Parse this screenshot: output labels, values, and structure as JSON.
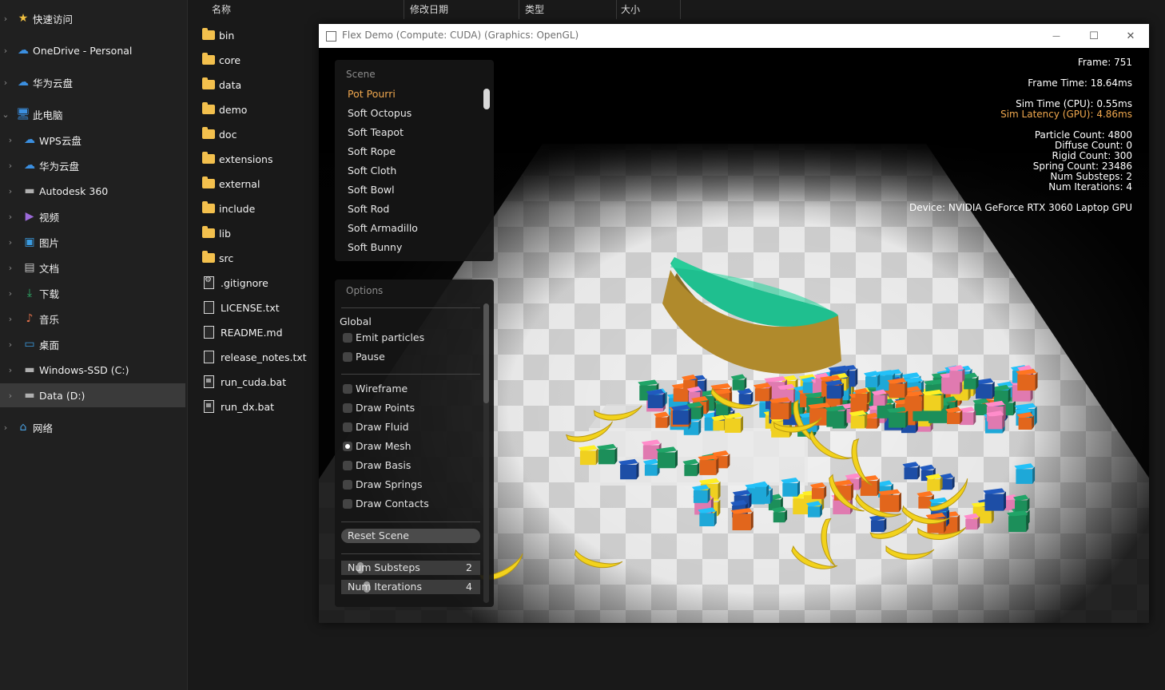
{
  "sidebar": {
    "items": [
      {
        "label": "快速访问",
        "icon": "star-icon"
      },
      {
        "label": "OneDrive - Personal",
        "icon": "cloud-icon"
      },
      {
        "label": "华为云盘",
        "icon": "cloud-icon"
      },
      {
        "label": "此电脑",
        "icon": "computer-icon"
      },
      {
        "label": "WPS云盘",
        "icon": "cloud-icon"
      },
      {
        "label": "华为云盘",
        "icon": "cloud-icon"
      },
      {
        "label": "Autodesk 360",
        "icon": "drive-icon"
      },
      {
        "label": "视频",
        "icon": "video-icon"
      },
      {
        "label": "图片",
        "icon": "picture-icon"
      },
      {
        "label": "文档",
        "icon": "document-icon"
      },
      {
        "label": "下载",
        "icon": "download-icon"
      },
      {
        "label": "音乐",
        "icon": "music-icon"
      },
      {
        "label": "桌面",
        "icon": "desktop-icon"
      },
      {
        "label": "Windows-SSD (C:)",
        "icon": "drive-icon"
      },
      {
        "label": "Data (D:)",
        "icon": "drive-icon",
        "selected": true
      },
      {
        "label": "网络",
        "icon": "network-icon"
      }
    ]
  },
  "columns": {
    "name": "名称",
    "date": "修改日期",
    "type": "类型",
    "size": "大小"
  },
  "files": [
    {
      "name": "bin",
      "kind": "folder"
    },
    {
      "name": "core",
      "kind": "folder"
    },
    {
      "name": "data",
      "kind": "folder"
    },
    {
      "name": "demo",
      "kind": "folder"
    },
    {
      "name": "doc",
      "kind": "folder"
    },
    {
      "name": "extensions",
      "kind": "folder"
    },
    {
      "name": "external",
      "kind": "folder"
    },
    {
      "name": "include",
      "kind": "folder"
    },
    {
      "name": "lib",
      "kind": "folder"
    },
    {
      "name": "src",
      "kind": "folder"
    },
    {
      "name": ".gitignore",
      "kind": "config"
    },
    {
      "name": "LICENSE.txt",
      "kind": "text"
    },
    {
      "name": "README.md",
      "kind": "text"
    },
    {
      "name": "release_notes.txt",
      "kind": "text"
    },
    {
      "name": "run_cuda.bat",
      "kind": "batch"
    },
    {
      "name": "run_dx.bat",
      "kind": "batch"
    }
  ],
  "window": {
    "title": "Flex Demo (Compute: CUDA) (Graphics: OpenGL)",
    "minimize": "—",
    "maximize": "☐",
    "close": "✕"
  },
  "scene_panel": {
    "header": "Scene",
    "items": [
      "Pot Pourri",
      "Soft Octopus",
      "Soft Teapot",
      "Soft Rope",
      "Soft Cloth",
      "Soft Bowl",
      "Soft Rod",
      "Soft Armadillo",
      "Soft Bunny"
    ],
    "active_index": 0
  },
  "options_panel": {
    "header": "Options",
    "global_label": "Global",
    "emit_particles": "Emit particles",
    "pause": "Pause",
    "wireframe": "Wireframe",
    "draw_points": "Draw Points",
    "draw_fluid": "Draw Fluid",
    "draw_mesh": "Draw Mesh",
    "draw_basis": "Draw Basis",
    "draw_springs": "Draw Springs",
    "draw_contacts": "Draw Contacts",
    "draw_mesh_checked": true,
    "reset_scene": "Reset Scene",
    "num_substeps_label": "Num Substeps",
    "num_substeps_value": "2",
    "num_iterations_label": "Num Iterations",
    "num_iterations_value": "4"
  },
  "stats": {
    "frame": "Frame: 751",
    "frame_time": "Frame Time: 18.64ms",
    "sim_time": "Sim Time (CPU): 0.55ms",
    "sim_latency": "Sim Latency (GPU): 4.86ms",
    "particle_count": "Particle Count: 4800",
    "diffuse_count": "Diffuse Count: 0",
    "rigid_count": "Rigid Count: 300",
    "spring_count": "Spring Count: 23486",
    "num_substeps": "Num Substeps: 2",
    "num_iterations": "Num Iterations: 4",
    "device": "Device: NVIDIA GeForce RTX 3060 Laptop GPU"
  },
  "colors": {
    "accent_orange": "#f0a84e",
    "folder_yellow": "#f3c04d",
    "cloth_green": "#1fbf8f",
    "banana_yellow": "#f2d21c"
  }
}
